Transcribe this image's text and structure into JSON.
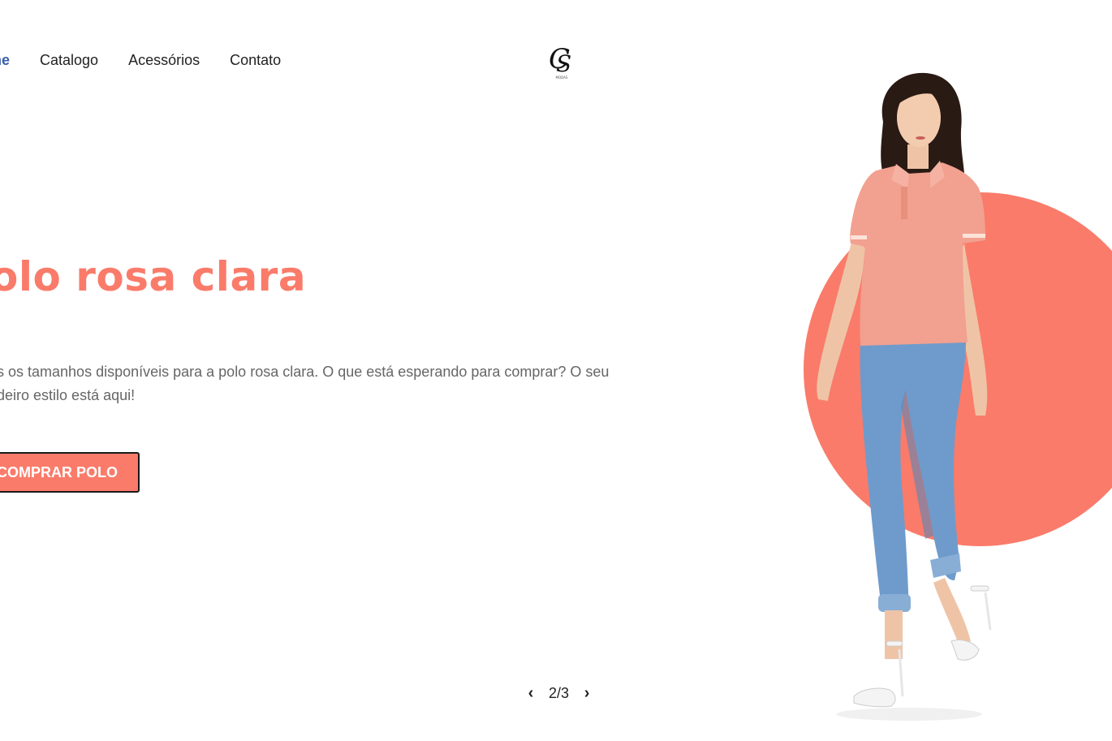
{
  "nav": {
    "items": [
      {
        "label": "Home",
        "active": true
      },
      {
        "label": "Catalogo",
        "active": false
      },
      {
        "label": "Acessórios",
        "active": false
      },
      {
        "label": "Contato",
        "active": false
      }
    ],
    "visible_active_fragment": "me"
  },
  "logo": {
    "letters": "CS",
    "subtitle": "MODAS"
  },
  "hero": {
    "title": "Polo rosa clara",
    "title_visible": "olo rosa clara",
    "description_line1": "os os tamanhos disponíveis para a polo rosa clara. O que está esperando para comprar? O seu",
    "description_line2": "adeiro estilo está aqui!",
    "button_label": "COMPRAR POLO",
    "accent_color": "#fa7b6a"
  },
  "slider": {
    "current": 2,
    "total": 3,
    "indicator": "2/3",
    "prev_icon": "chevron-left-icon",
    "next_icon": "chevron-right-icon"
  },
  "image": {
    "subject": "woman-in-pink-polo-and-jeans",
    "circle_color": "#fa7b6a",
    "shirt_color": "#f2a08f",
    "jeans_color": "#6e9bcb"
  }
}
